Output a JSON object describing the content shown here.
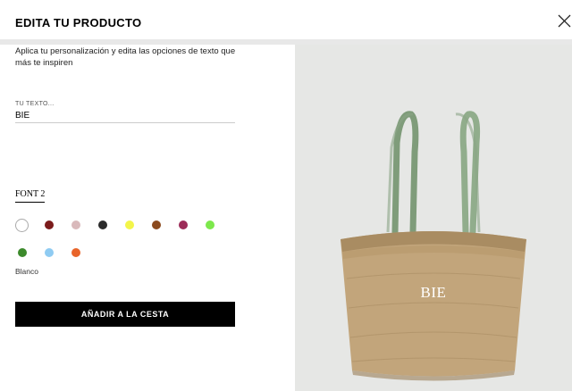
{
  "header": {
    "title": "EDITA TU PRODUCTO"
  },
  "description": "Aplica tu personalización y edita las opciones de texto que más te inspiren",
  "text_field": {
    "label": "TU TEXTO...",
    "value": "BIE"
  },
  "font_tab": {
    "label": "FONT 2"
  },
  "colors": [
    {
      "name": "Blanco",
      "hex": "#ffffff",
      "selected": true
    },
    {
      "hex": "#7b1c1c"
    },
    {
      "hex": "#d9b9bb"
    },
    {
      "hex": "#2b2b2b"
    },
    {
      "hex": "#f3f54a"
    },
    {
      "hex": "#8b4a1e"
    },
    {
      "hex": "#9c2c58"
    },
    {
      "hex": "#7de84c"
    },
    {
      "hex": "#3c8a2c"
    },
    {
      "hex": "#8fcbf2"
    },
    {
      "hex": "#e8642a"
    }
  ],
  "selected_color_name": "Blanco",
  "add_to_cart_label": "AÑADIR A LA CESTA",
  "preview": {
    "bag_text": "BIE",
    "bag_color": "#c2a57b",
    "handle_color": "#8aa585",
    "background": "#e6e7e5"
  }
}
